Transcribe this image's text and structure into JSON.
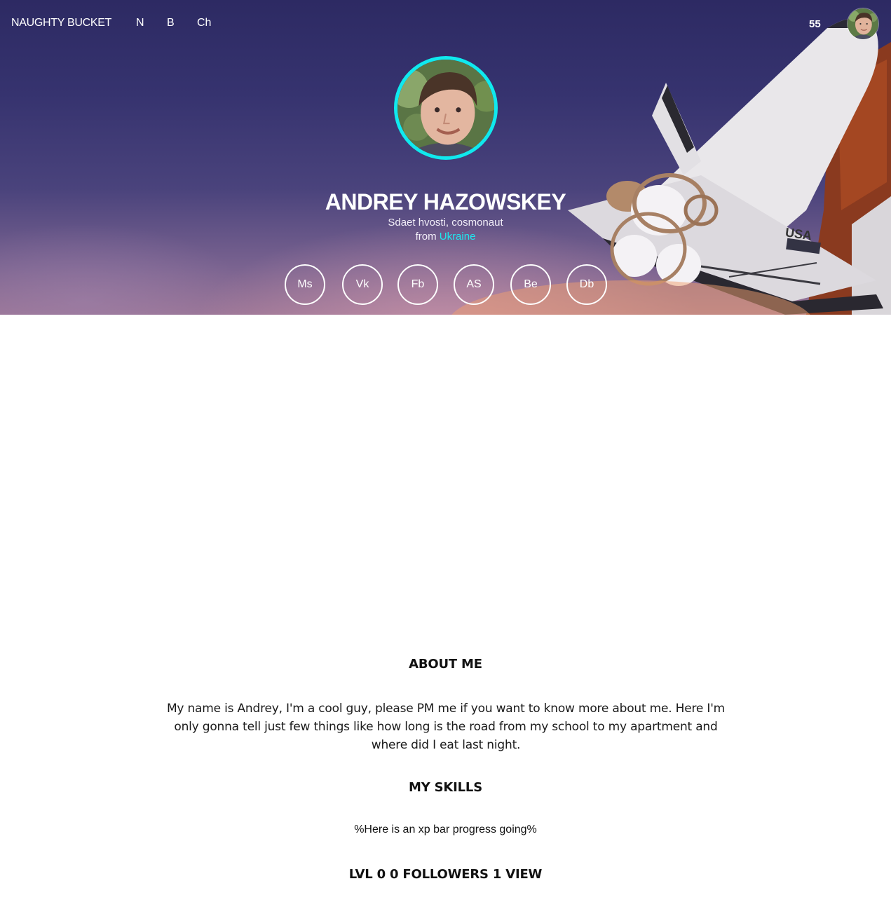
{
  "nav": {
    "brand": "NAUGHTY BUCKET",
    "links": [
      "N",
      "B",
      "Ch"
    ],
    "count": "55"
  },
  "profile": {
    "name": "ANDREY HAZOWSKEY",
    "subtitle": "Sdaet hvosti, cosmonaut",
    "from_label": "from",
    "country": "Ukraine",
    "accent_color": "#10e9ee"
  },
  "socials": [
    "Ms",
    "Vk",
    "Fb",
    "AS",
    "Be",
    "Db"
  ],
  "about": {
    "title": "ABOUT ME",
    "text": "My name is Andrey, I'm a cool guy, please PM me if you want to know more about me. Here I'm only gonna tell just few things like how long is the road from my school to my apartment and where did I eat last night."
  },
  "skills": {
    "title": "MY SKILLS",
    "xp_text": "%Here is an xp bar progress going%"
  },
  "stats": {
    "text": "LVL 0 0 FOLLOWERS 1 VIEW"
  }
}
